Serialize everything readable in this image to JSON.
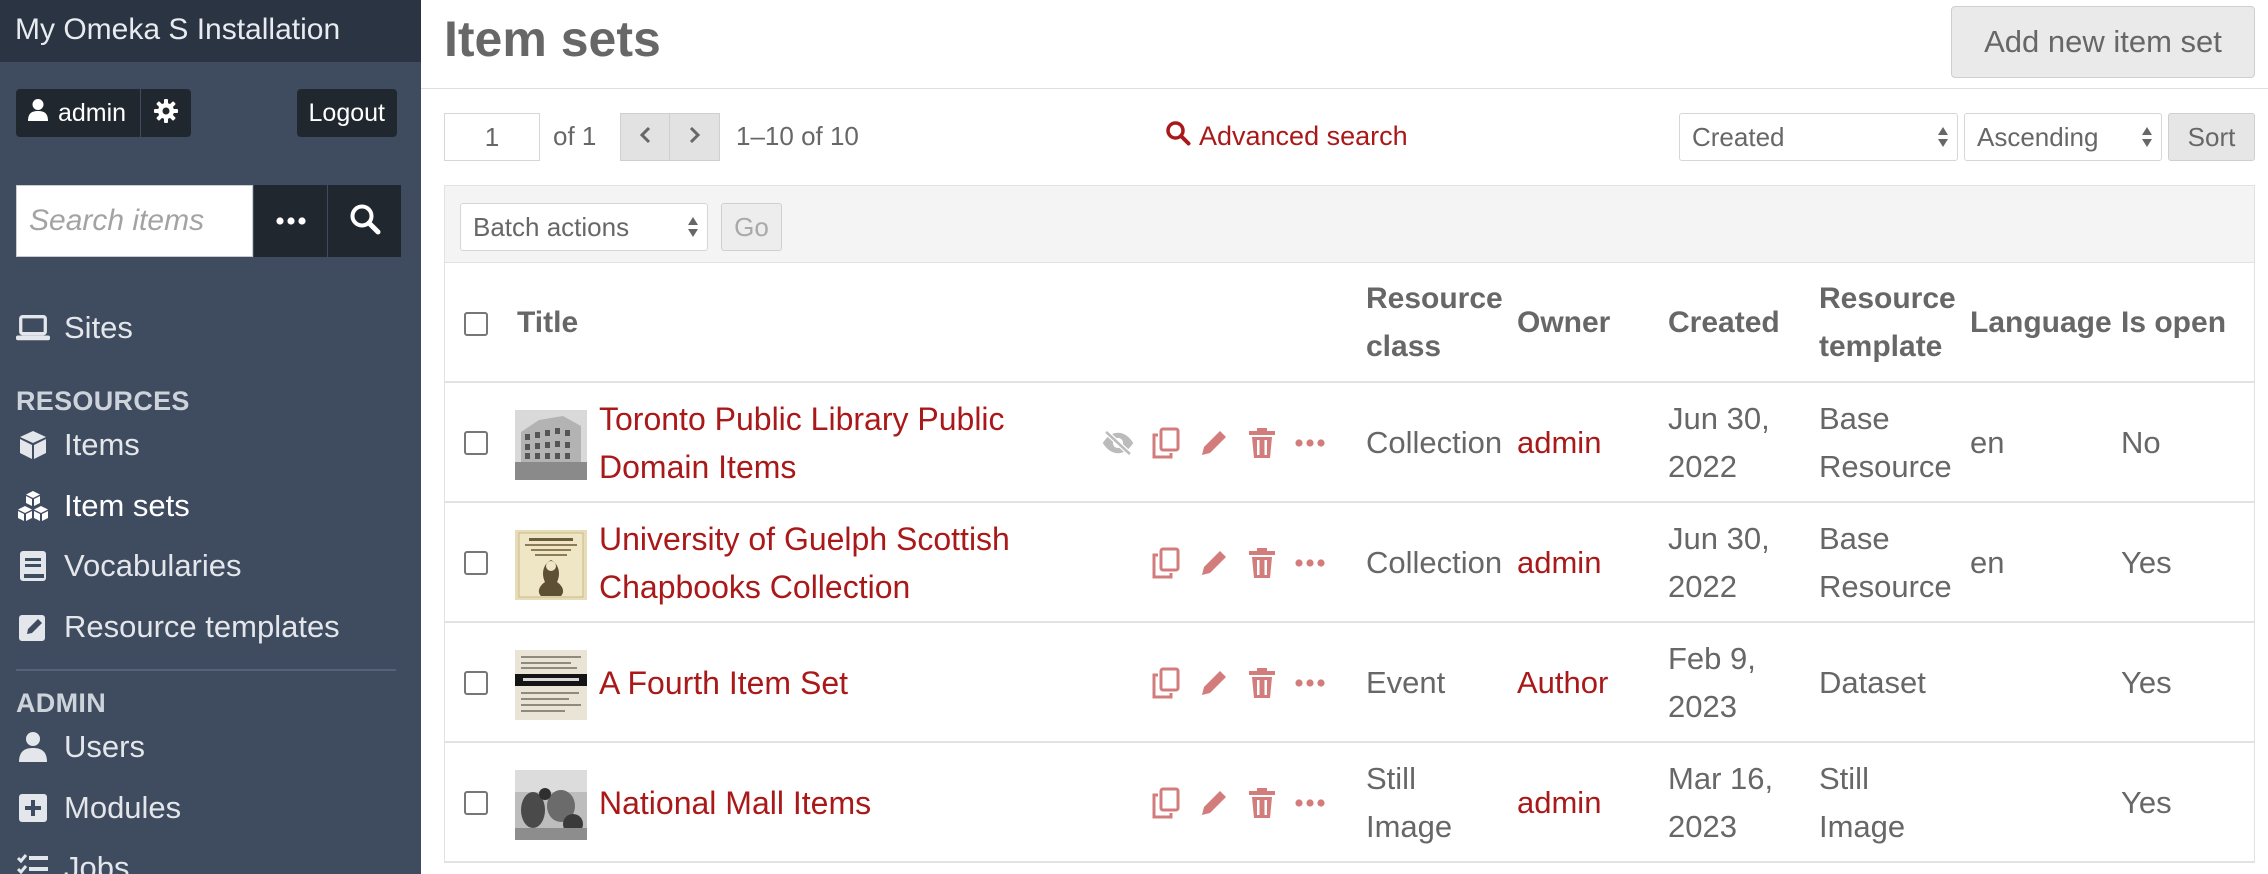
{
  "sidebar": {
    "installation_title": "My Omeka S Installation",
    "user_label": "admin",
    "logout_label": "Logout",
    "search_placeholder": "Search items",
    "sites_label": "Sites",
    "resources_heading": "RESOURCES",
    "items_label": "Items",
    "item_sets_label": "Item sets",
    "vocabularies_label": "Vocabularies",
    "resource_templates_label": "Resource templates",
    "admin_heading": "ADMIN",
    "users_label": "Users",
    "modules_label": "Modules",
    "jobs_label": "Jobs"
  },
  "header": {
    "title": "Item sets",
    "add_button": "Add new item set"
  },
  "pagination": {
    "page_value": "1",
    "of_pages": "of 1",
    "range": "1–10 of 10"
  },
  "search": {
    "advanced_label": "Advanced search"
  },
  "sorting": {
    "sort_by": "Created",
    "order": "Ascending",
    "button": "Sort"
  },
  "batch": {
    "select_label": "Batch actions",
    "go_label": "Go"
  },
  "table": {
    "headers": {
      "title": "Title",
      "resource_class_1": "Resource",
      "resource_class_2": "class",
      "owner": "Owner",
      "created": "Created",
      "resource_template_1": "Resource",
      "resource_template_2": "template",
      "language": "Language",
      "is_open": "Is open"
    },
    "rows": [
      {
        "title_1": "Toronto Public Library Public",
        "title_2": "Domain Items",
        "resource_class": "Collection",
        "owner": "admin",
        "created_1": "Jun 30,",
        "created_2": "2022",
        "template_1": "Base",
        "template_2": "Resource",
        "language": "en",
        "is_open": "No"
      },
      {
        "title_1": "University of Guelph Scottish",
        "title_2": "Chapbooks Collection",
        "resource_class": "Collection",
        "owner": "admin",
        "created_1": "Jun 30,",
        "created_2": "2022",
        "template_1": "Base",
        "template_2": "Resource",
        "language": "en",
        "is_open": "Yes"
      },
      {
        "title_1": "A Fourth Item Set",
        "resource_class": "Event",
        "owner": "Author",
        "created_1": "Feb 9,",
        "created_2": "2023",
        "template_1": "Dataset",
        "language": "",
        "is_open": "Yes"
      },
      {
        "title_1": "National Mall Items",
        "resource_class_1": "Still",
        "resource_class_2": "Image",
        "owner": "admin",
        "created_1": "Mar 16,",
        "created_2": "2023",
        "template_1": "Still",
        "template_2": "Image",
        "language": "",
        "is_open": "Yes"
      }
    ]
  },
  "colors": {
    "sidebar_bg": "#3f4b5e",
    "sidebar_title_bg": "#2b3443",
    "link_red": "#a91919",
    "text_gray": "#676767"
  },
  "icons": [
    "user-icon",
    "gear-icon",
    "ellipsis-icon",
    "search-icon",
    "laptop-icon",
    "cube-icon",
    "cubes-icon",
    "book-icon",
    "pencil-square-icon",
    "users-icon",
    "plus-square-icon",
    "tasks-icon",
    "chevron-left-icon",
    "chevron-right-icon",
    "eye-slash-icon",
    "copy-icon",
    "pencil-icon",
    "trash-icon"
  ]
}
